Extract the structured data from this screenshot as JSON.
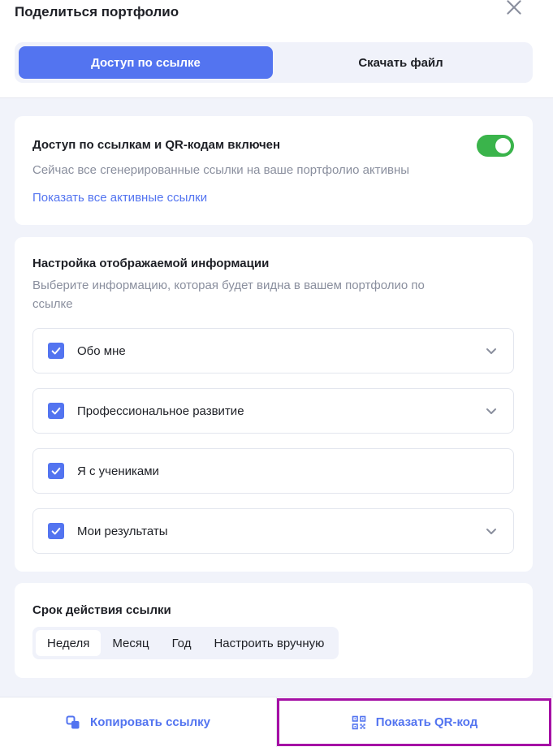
{
  "header": {
    "title": "Поделиться портфолио",
    "tabs": [
      {
        "label": "Доступ по ссылке",
        "active": true
      },
      {
        "label": "Скачать файл",
        "active": false
      }
    ]
  },
  "access": {
    "title": "Доступ по ссылкам и QR-кодам включен",
    "subtitle": "Сейчас все сгенерированные ссылки на ваше портфолио активны",
    "link": "Показать все активные ссылки",
    "toggle_on": true
  },
  "display": {
    "title": "Настройка отображаемой информации",
    "subtitle_line1": "Выберите информацию, которая будет видна в вашем портфолио по",
    "subtitle_line2": "ссылке",
    "sections": [
      {
        "label": "Обо мне",
        "checked": true,
        "expandable": true
      },
      {
        "label": "Профессиональное развитие",
        "checked": true,
        "expandable": true
      },
      {
        "label": "Я с учениками",
        "checked": true,
        "expandable": false
      },
      {
        "label": "Мои результаты",
        "checked": true,
        "expandable": true
      }
    ]
  },
  "validity": {
    "title": "Срок действия ссылки",
    "options": [
      {
        "label": "Неделя",
        "active": true
      },
      {
        "label": "Месяц",
        "active": false
      },
      {
        "label": "Год",
        "active": false
      },
      {
        "label": "Настроить вручную",
        "active": false
      }
    ]
  },
  "footer": {
    "copy_label": "Копировать ссылку",
    "qr_label": "Показать QR-код"
  },
  "colors": {
    "accent": "#5374f0",
    "toggle_on": "#3ab44b",
    "highlight": "#a50fa5"
  }
}
